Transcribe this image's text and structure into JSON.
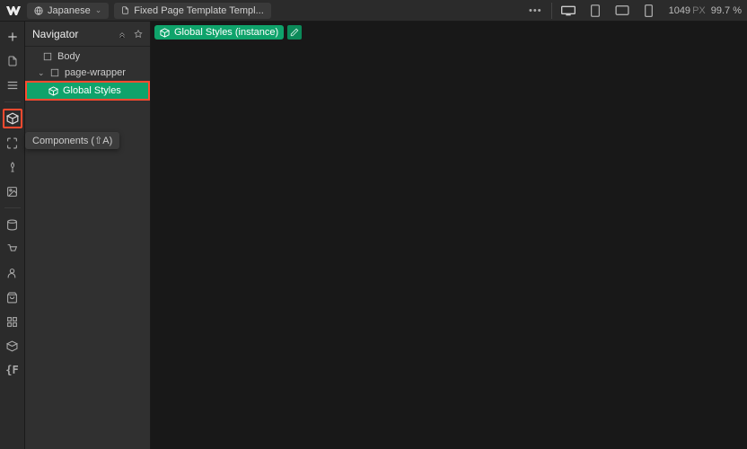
{
  "topbar": {
    "language_label": "Japanese",
    "template_label": "Fixed Page Template Templ...",
    "viewport_px": "1049",
    "viewport_unit": "PX",
    "zoom": "99.7 %"
  },
  "navigator": {
    "title": "Navigator",
    "tree": {
      "body": "Body",
      "page_wrapper": "page-wrapper",
      "global_styles": "Global Styles"
    }
  },
  "tooltip": "Components (⇧A)",
  "crumb": {
    "label": "Global Styles (instance)"
  },
  "colors": {
    "highlight": "#ff4a2f",
    "green": "#0fa36b"
  }
}
